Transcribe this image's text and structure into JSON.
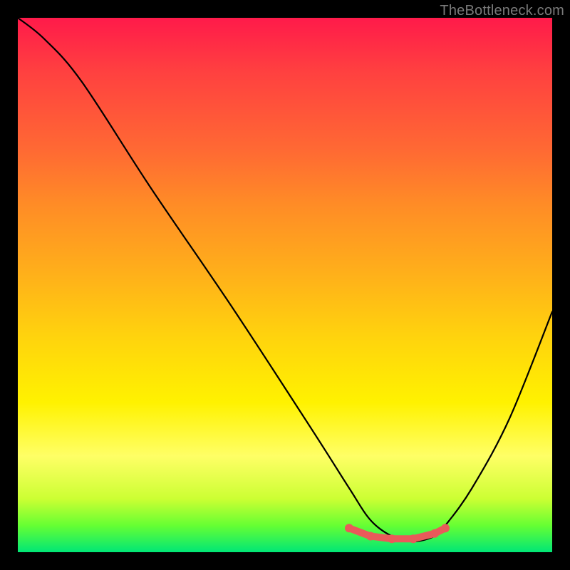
{
  "watermark": "TheBottleneck.com",
  "chart_data": {
    "type": "line",
    "title": "",
    "xlabel": "",
    "ylabel": "",
    "xlim": [
      0,
      100
    ],
    "ylim": [
      0,
      100
    ],
    "grid": false,
    "series": [
      {
        "name": "bottleneck-curve",
        "x": [
          0,
          5,
          12,
          25,
          40,
          55,
          62,
          66,
          70,
          74,
          78,
          80,
          85,
          92,
          100
        ],
        "y": [
          100,
          96,
          88,
          68,
          46,
          23,
          12,
          6,
          3,
          2,
          3,
          5,
          12,
          25,
          45
        ]
      }
    ],
    "optimal_band": {
      "x": [
        62,
        66,
        70,
        74,
        78,
        80
      ],
      "y": [
        4.5,
        3,
        2.5,
        2.5,
        3.5,
        4.5
      ]
    },
    "background_gradient": {
      "top": "#ff1a4a",
      "bottom": "#00e676"
    }
  }
}
